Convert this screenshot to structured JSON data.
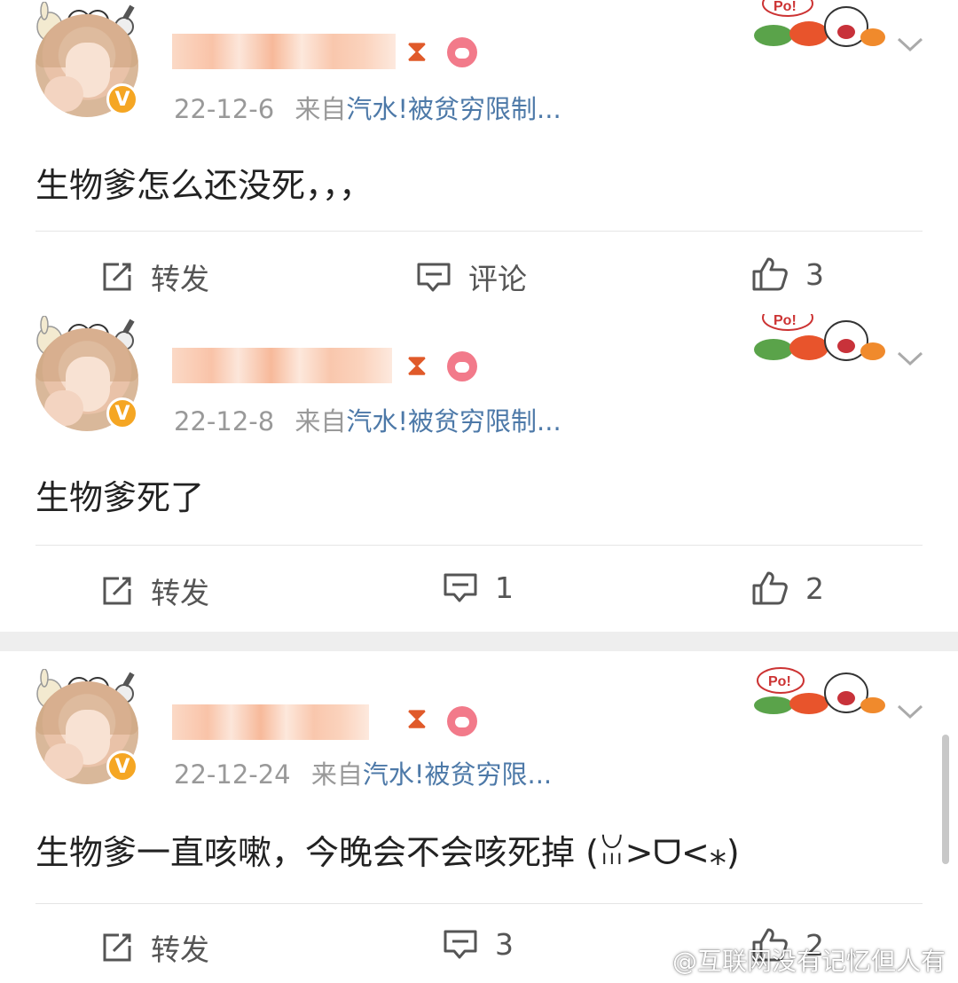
{
  "posts": [
    {
      "date": "22-12-6",
      "source_prefix": "来自",
      "source": "汽水!被贫穷限制...",
      "text": "生物爹怎么还没死，，，",
      "repost_label": "转发",
      "comment_label": "评论",
      "like_count": "3"
    },
    {
      "date": "22-12-8",
      "source_prefix": "来自",
      "source": "汽水!被贫穷限制...",
      "text": "生物爹死了",
      "repost_label": "转发",
      "comment_label": "1",
      "like_count": "2"
    },
    {
      "date": "22-12-24",
      "source_prefix": "来自",
      "source": "汽水!被贫穷限...",
      "text": "生物爹一直咳嗽，今晚会不会咳死掉 (ꈍ>ᗜ<⁎)",
      "repost_label": "转发",
      "comment_label": "3",
      "like_count": "2"
    }
  ],
  "badges": {
    "verified": "V",
    "sticker_text": "Po!"
  },
  "icons": {
    "repost": "repost-icon",
    "comment": "comment-icon",
    "like": "like-icon",
    "hourglass": "hourglass-icon",
    "pig": "pig-icon",
    "more": "chevron-down-icon"
  },
  "colors": {
    "link": "#4d79a8",
    "meta": "#999999",
    "badge": "#f5a623",
    "text": "#222222"
  },
  "watermark": "@互联网没有记忆但人有"
}
